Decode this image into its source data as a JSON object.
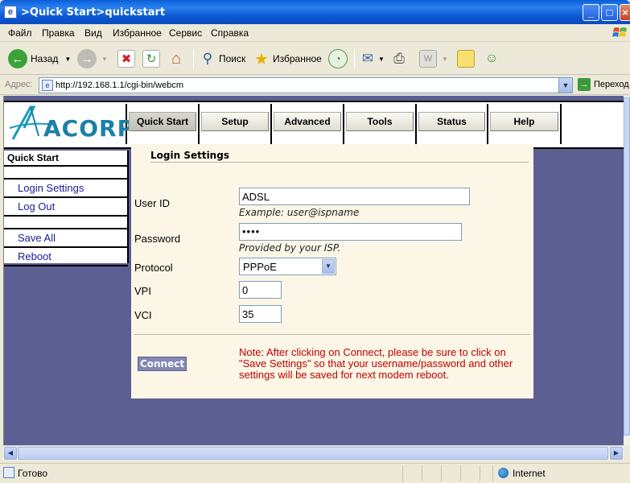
{
  "window": {
    "title": ">Quick Start>quickstart",
    "minimize": "_",
    "maximize": "□",
    "close": "×"
  },
  "menu": {
    "items": [
      "Файл",
      "Правка",
      "Вид",
      "Избранное",
      "Сервис",
      "Справка"
    ]
  },
  "toolbar": {
    "back_label": "Назад",
    "search_label": "Поиск",
    "favorites_label": "Избранное"
  },
  "address": {
    "label": "Адрес:",
    "url": "http://192.168.1.1/cgi-bin/webcm",
    "go_label": "Переход"
  },
  "router": {
    "logo_text": "ACORP",
    "nav_tabs": [
      "Quick Start",
      "Setup",
      "Advanced",
      "Tools",
      "Status",
      "Help"
    ],
    "active_tab": "Quick Start",
    "sidebar": {
      "heading": "Quick Start",
      "items": [
        "Login Settings",
        "Log Out",
        "Save All",
        "Reboot"
      ]
    },
    "form": {
      "section_title": "Login Settings",
      "user_id_label": "User ID",
      "user_id_value": "ADSL",
      "user_id_hint": "Example: user@ispname",
      "password_label": "Password",
      "password_value": "••••",
      "password_hint": "Provided by your ISP.",
      "protocol_label": "Protocol",
      "protocol_value": "PPPoE",
      "vpi_label": "VPI",
      "vpi_value": "0",
      "vci_label": "VCI",
      "vci_value": "35",
      "connect_label": "Connect",
      "note": "Note: After clicking on Connect, please be sure to click on \"Save Settings\" so that your username/password and other settings will be saved for next modem reboot."
    }
  },
  "status": {
    "text": "Готово",
    "zone": "Internet"
  },
  "colors": {
    "page_background": "#5b5f91",
    "panel_background": "#fbf6e6",
    "note_color": "#c00000",
    "link_color": "#1a1a9a",
    "connect_button": "#8388b4"
  }
}
